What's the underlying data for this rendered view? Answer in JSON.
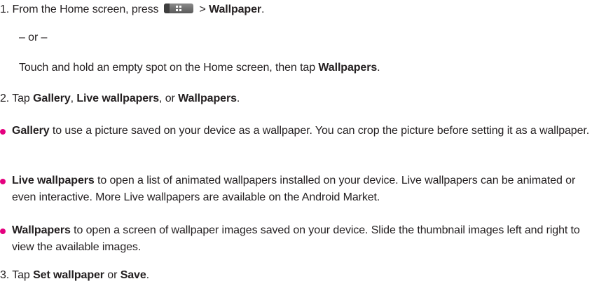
{
  "step1": {
    "number": "1.",
    "text_before": "From the Home screen, press",
    "key_icon": "menu-key-icon",
    "text_arrow": ">",
    "target": "Wallpaper",
    "end": "."
  },
  "or_divider": "– or –",
  "step1_alt": {
    "text": "Touch and hold an empty spot on the Home screen, then tap",
    "target": "Wallpapers",
    "end": "."
  },
  "step2": {
    "number": "2.",
    "text_before": "Tap",
    "option1": "Gallery",
    "sep1": ",",
    "option2": "Live wallpapers",
    "sep2": ", or",
    "option3": "Wallpapers",
    "end": "."
  },
  "bullets": [
    {
      "term": "Gallery",
      "text": " to use a picture saved on your device as a wallpaper. You can crop the picture before setting it as a wallpaper."
    },
    {
      "term": "Live wallpapers",
      "text": " to open a list of animated wallpapers installed on your device. Live wallpapers can be animated or even interactive. More Live wallpapers are available on the Android Market."
    },
    {
      "term": "Wallpapers",
      "text": " to open a screen of wallpaper images saved on your device. Slide the thumbnail images left and right to view the available images."
    }
  ],
  "step3": {
    "number": "3.",
    "text_before": "Tap",
    "option1": "Set wallpaper",
    "sep": "or",
    "option2": "Save",
    "end": "."
  },
  "colors": {
    "bullet": "#e4007f",
    "text": "#231f20"
  }
}
